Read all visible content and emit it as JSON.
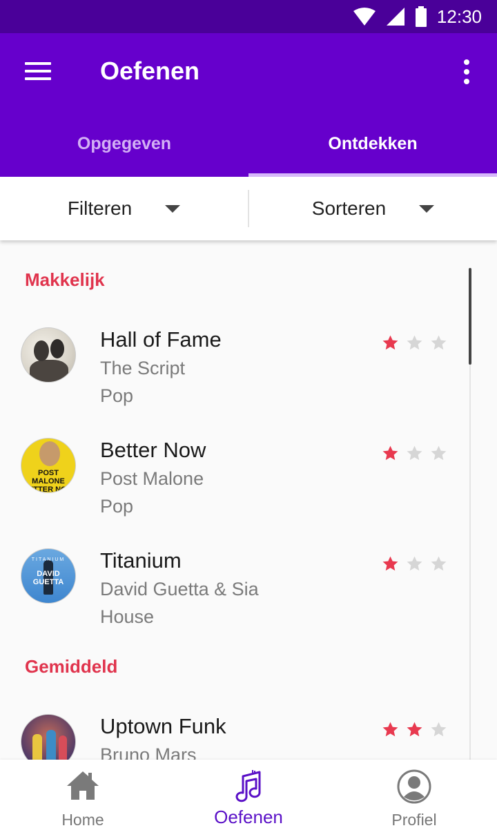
{
  "status_bar": {
    "time": "12:30"
  },
  "app_bar": {
    "title": "Oefenen"
  },
  "tabs": [
    {
      "label": "Opgegeven",
      "active": false
    },
    {
      "label": "Ontdekken",
      "active": true
    }
  ],
  "filters": {
    "filter_label": "Filteren",
    "sort_label": "Sorteren"
  },
  "sections": [
    {
      "title": "Makkelijk",
      "songs": [
        {
          "title": "Hall of Fame",
          "artist": "The Script",
          "genre": "Pop",
          "rating": 1,
          "max_rating": 3
        },
        {
          "title": "Better Now",
          "artist": "Post Malone",
          "genre": "Pop",
          "rating": 1,
          "max_rating": 3,
          "cover_text": "POST MALONE BETTER NOW"
        },
        {
          "title": "Titanium",
          "artist": "David Guetta & Sia",
          "genre": "House",
          "rating": 1,
          "max_rating": 3,
          "cover_text": "DAVID GUETTA",
          "cover_subtext": "TITANIUM"
        }
      ]
    },
    {
      "title": "Gemiddeld",
      "songs": [
        {
          "title": "Uptown Funk",
          "artist": "Bruno Mars",
          "genre": "",
          "rating": 2,
          "max_rating": 3
        }
      ]
    }
  ],
  "bottom_nav": [
    {
      "label": "Home",
      "icon": "home-icon",
      "active": false
    },
    {
      "label": "Oefenen",
      "icon": "music-note-icon",
      "active": true
    },
    {
      "label": "Profiel",
      "icon": "profile-icon",
      "active": false
    }
  ],
  "colors": {
    "primary": "#6600cc",
    "status_bar": "#4a0099",
    "accent": "#e0344d",
    "star_on": "#e8394f",
    "star_off": "#d6d6d6",
    "nav_active": "#5a10c7"
  }
}
